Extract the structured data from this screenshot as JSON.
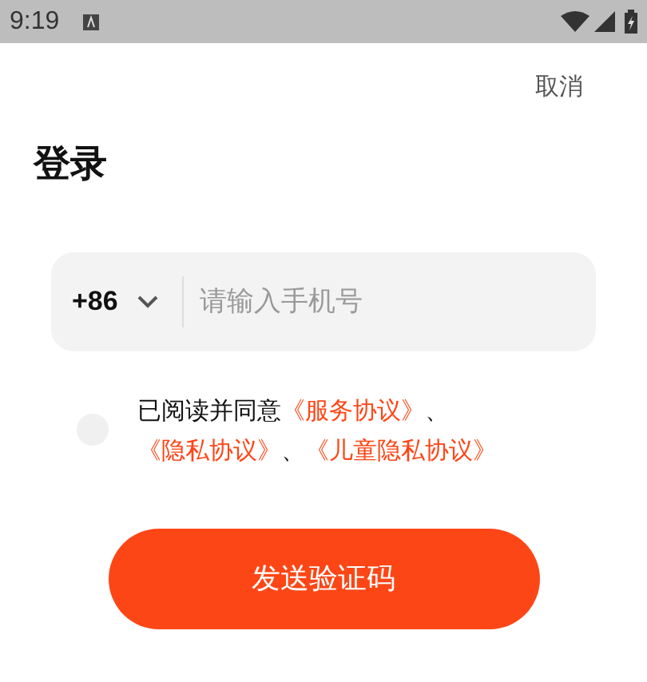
{
  "status_bar": {
    "time": "9:19"
  },
  "cancel": "取消",
  "title": "登录",
  "phone": {
    "country_code": "+86",
    "placeholder": "请输入手机号"
  },
  "agreement": {
    "checked": false,
    "segments": [
      {
        "kind": "text",
        "text": "已阅读并同意"
      },
      {
        "kind": "link",
        "text": "《服务协议》"
      },
      {
        "kind": "text",
        "text": "、"
      },
      {
        "kind": "link",
        "text": "《隐私协议》"
      },
      {
        "kind": "text",
        "text": "、"
      },
      {
        "kind": "link",
        "text": "《儿童隐私协议》"
      }
    ]
  },
  "submit": "发送验证码"
}
